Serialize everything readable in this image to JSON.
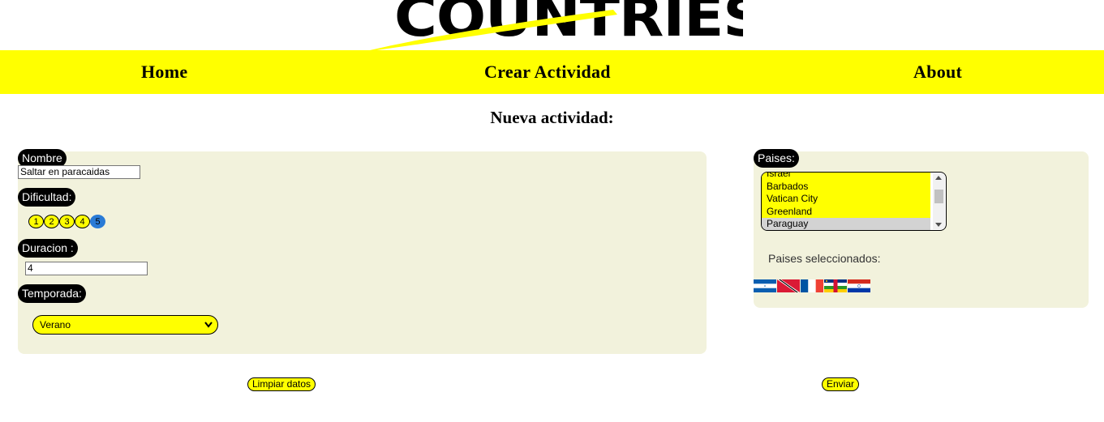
{
  "logo": {
    "text": "COUNTRIES"
  },
  "nav": {
    "home": "Home",
    "create": "Crear Actividad",
    "about": "About"
  },
  "page": {
    "title": "Nueva actividad:"
  },
  "form": {
    "name_label": "Nombre",
    "name_value": "Saltar en paracaidas",
    "difficulty_label": "Dificultad:",
    "difficulty_options": [
      "1",
      "2",
      "3",
      "4",
      "5"
    ],
    "difficulty_selected": "5",
    "duration_label": "Duracion :",
    "duration_value": "4",
    "season_label": "Temporada:",
    "season_value": "Verano"
  },
  "countries": {
    "label": "Paises:",
    "options": [
      "Israel",
      "Barbados",
      "Vatican City",
      "Greenland",
      "Paraguay"
    ],
    "highlighted": "Paraguay",
    "selected_label": "Paises seleccionados:",
    "selected_flags": [
      "Honduras",
      "Trinidad and Tobago",
      "France",
      "Central African Republic",
      "Paraguay"
    ]
  },
  "actions": {
    "clear": "Limpiar datos",
    "send": "Enviar"
  },
  "colors": {
    "accent": "#ffff00",
    "panel": "#f2f2dc",
    "selected_radio": "#2a7bd6"
  }
}
